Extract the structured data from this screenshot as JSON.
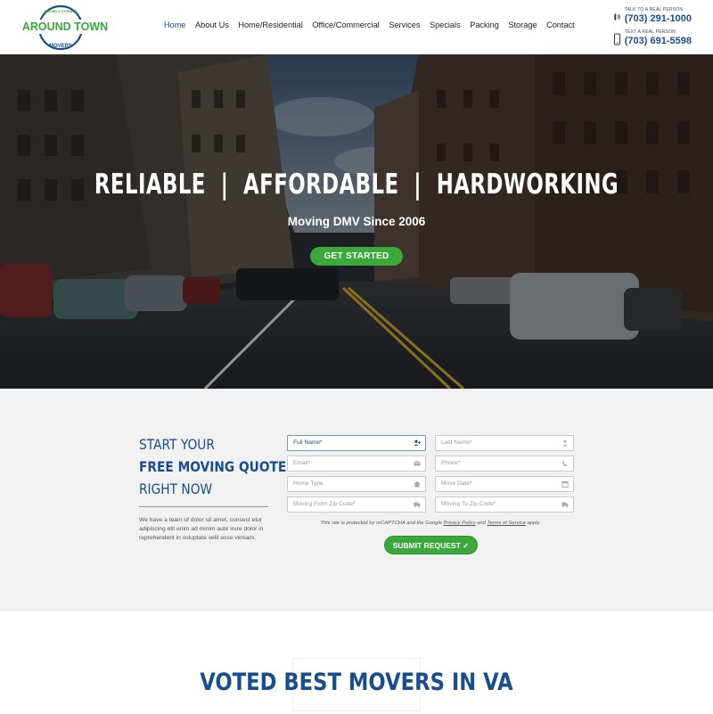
{
  "brand": {
    "logo_top": "MOVING & STORAGE",
    "logo_main": "AROUND TOWN",
    "logo_bottom": "MOVERS",
    "green": "#3aa83a",
    "blue": "#1a4e8a"
  },
  "nav": {
    "items": [
      "Home",
      "About Us",
      "Home/Residential",
      "Office/Commercial",
      "Services",
      "Specials",
      "Packing",
      "Storage",
      "Contact"
    ],
    "active": "Home"
  },
  "contact": {
    "talk_label": "TALK TO A REAL PERSON",
    "talk_number": "(703) 291-1000",
    "text_label": "TEXT A REAL PERSON",
    "text_number": "(703) 691-5598"
  },
  "hero": {
    "title": "RELIABLE  |  AFFORDABLE  |  HARDWORKING",
    "subtitle": "Moving DMV Since 2006",
    "cta": "GET STARTED"
  },
  "quote": {
    "line1": "START YOUR",
    "line2": "FREE MOVING QUOTE",
    "line3": "RIGHT NOW",
    "body": "We have a team of dolor sit amet, consect etur adipiscing elit enim ad minim aute irure dolor in reprehenderit in voluptate velit esse veniam.",
    "fields": [
      {
        "placeholder": "Full Name*",
        "icon": "user-add-icon"
      },
      {
        "placeholder": "Last Name*",
        "icon": "user-icon"
      },
      {
        "placeholder": "Email*",
        "icon": "envelope-icon"
      },
      {
        "placeholder": "Phone*",
        "icon": "phone-icon"
      },
      {
        "placeholder": "Home Type",
        "icon": "home-icon"
      },
      {
        "placeholder": "Move Date*",
        "icon": "calendar-icon"
      },
      {
        "placeholder": "Moving From Zip Code*",
        "icon": "truck-icon"
      },
      {
        "placeholder": "Moving To Zip Code*",
        "icon": "truck-icon"
      }
    ],
    "recaptcha_pre": "This site is protected by reCAPTCHA and the Google",
    "privacy": "Privacy Policy",
    "and": "and",
    "terms": "Terms of Service",
    "apply": "apply.",
    "submit": "SUBMIT REQUEST ✓"
  },
  "voted": {
    "title": "VOTED BEST MOVERS IN VA"
  }
}
